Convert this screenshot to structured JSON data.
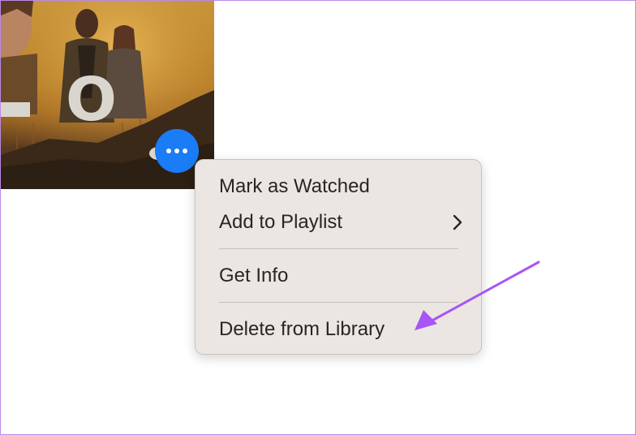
{
  "poster": {
    "title_letter": "O"
  },
  "more_button": {
    "icon": "ellipsis-icon",
    "color": "#1a7cf6"
  },
  "context_menu": {
    "items": [
      {
        "label": "Mark as Watched"
      },
      {
        "label": "Add to Playlist",
        "has_submenu": true
      },
      {
        "label": "Get Info"
      },
      {
        "label": "Delete from Library"
      }
    ]
  },
  "annotation": {
    "arrow_color": "#a855f7",
    "points_to": "Delete from Library"
  }
}
